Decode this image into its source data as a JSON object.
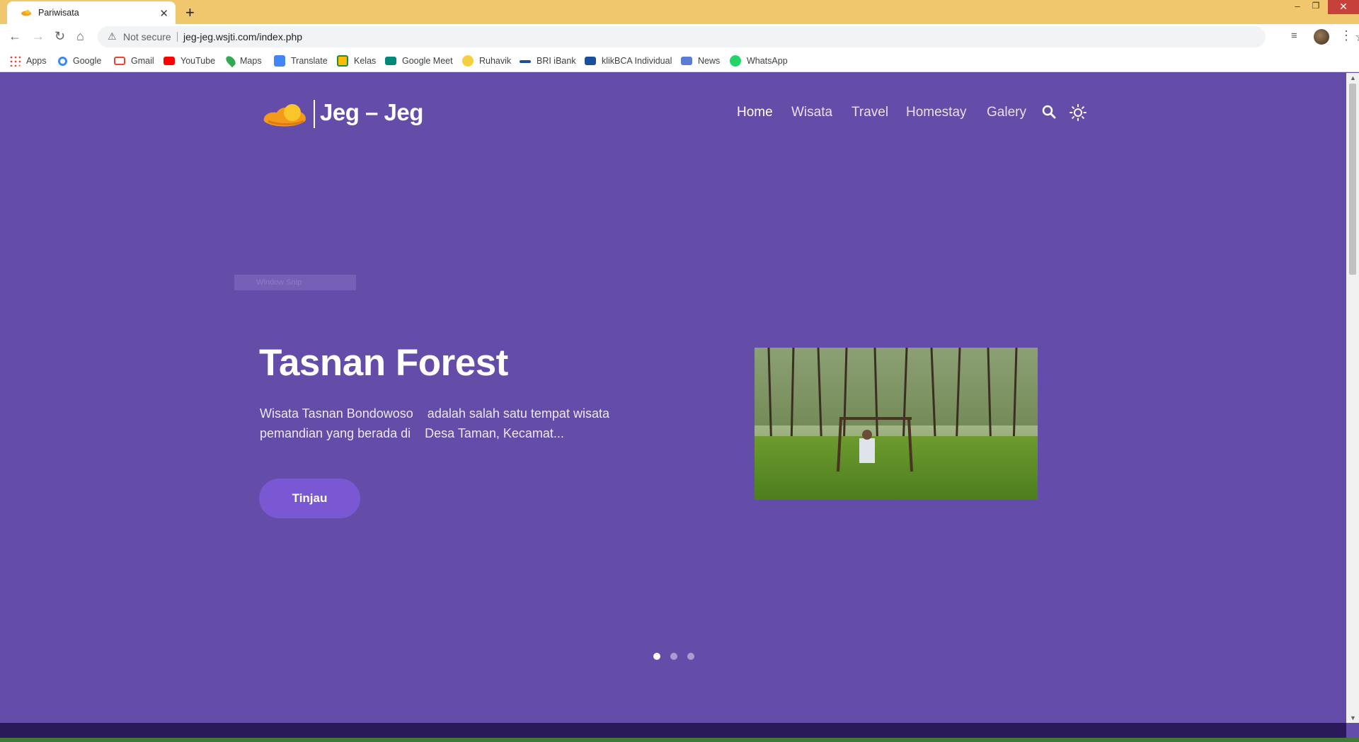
{
  "browser": {
    "tab_title": "Pariwisata",
    "security_label": "Not secure",
    "url": "jeg-jeg.wsjti.com/index.php",
    "bookmarks": [
      {
        "label": "Apps",
        "color": "#ea4335"
      },
      {
        "label": "Google",
        "color": "#4285f4"
      },
      {
        "label": "Gmail",
        "color": "#ea4335"
      },
      {
        "label": "YouTube",
        "color": "#ff0000"
      },
      {
        "label": "Maps",
        "color": "#34a853"
      },
      {
        "label": "Translate",
        "color": "#4285f4"
      },
      {
        "label": "Kelas",
        "color": "#fbbc05"
      },
      {
        "label": "Google Meet",
        "color": "#00897b"
      },
      {
        "label": "Ruhavik",
        "color": "#f4d03f"
      },
      {
        "label": "BRI iBank",
        "color": "#1a4f9c"
      },
      {
        "label": "klikBCA Individual",
        "color": "#1a4f9c"
      },
      {
        "label": "News",
        "color": "#5b7bd5"
      },
      {
        "label": "WhatsApp",
        "color": "#25d366"
      }
    ]
  },
  "site": {
    "logo_text": "Jeg – Jeg",
    "nav": [
      "Home",
      "Wisata",
      "Travel",
      "Homestay",
      "Galery"
    ],
    "overlay_label": "Window Snip"
  },
  "hero": {
    "title": "Tasnan Forest",
    "description_line1": "Wisata Tasnan Bondowoso    adalah salah satu tempat wisata",
    "description_line2": "pemandian yang berada di    Desa Taman, Kecamat...",
    "button_label": "Tinjau",
    "slides_total": 3,
    "active_slide": 1
  },
  "colors": {
    "page_bg": "#634da8",
    "button": "#7a58d3",
    "tabbar": "#f1c76d"
  }
}
